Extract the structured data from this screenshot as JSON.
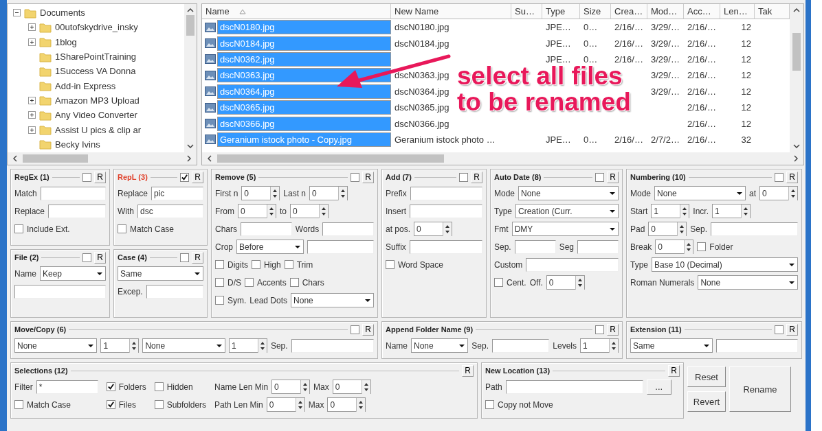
{
  "tree": {
    "items": [
      {
        "label": "Documents",
        "expanded": true,
        "children": [
          {
            "label": "00utofskydrive_insky",
            "expanded": false
          },
          {
            "label": "1blog",
            "expanded": false
          },
          {
            "label": "1SharePointTraining"
          },
          {
            "label": "1Success VA Donna"
          },
          {
            "label": "Add-in Express"
          },
          {
            "label": "Amazon MP3 Upload",
            "expanded": false
          },
          {
            "label": "Any Video Converter",
            "expanded": false
          },
          {
            "label": "Assist U pics & clip ar",
            "expanded": false
          },
          {
            "label": "Becky Ivins"
          }
        ]
      }
    ]
  },
  "file_list": {
    "columns": [
      "Name",
      "New Name",
      "Su…",
      "Type",
      "Size",
      "Crea…",
      "Mod…",
      "Acc…",
      "Len…",
      "Tak"
    ],
    "rows": [
      {
        "selected": true,
        "cells": [
          "dscN0180.jpg",
          "dscN0180.jpg",
          null,
          "JPE…",
          "0…",
          "2/16/…",
          "3/29/…",
          "2/16/…",
          "12"
        ]
      },
      {
        "selected": true,
        "cells": [
          "dscN0184.jpg",
          "dscN0184.jpg",
          null,
          "JPE…",
          "0…",
          "2/16/…",
          "3/29/…",
          "2/16/…",
          "12"
        ]
      },
      {
        "selected": true,
        "cells": [
          "dscN0362.jpg",
          null,
          null,
          "JPE…",
          "0…",
          "2/16/…",
          "3/29/…",
          "2/16/…",
          "12"
        ]
      },
      {
        "selected": true,
        "cells": [
          "dscN0363.jpg",
          "dscN0363.jpg",
          null,
          null,
          null,
          null,
          "3/29/…",
          "2/16/…",
          "12"
        ]
      },
      {
        "selected": true,
        "cells": [
          "dscN0364.jpg",
          "dscN0364.jpg",
          null,
          null,
          null,
          null,
          "3/29/…",
          "2/16/…",
          "12"
        ]
      },
      {
        "selected": true,
        "cells": [
          "dscN0365.jpg",
          "dscN0365.jpg",
          null,
          null,
          null,
          null,
          null,
          "2/16/…",
          "12"
        ]
      },
      {
        "selected": true,
        "cells": [
          "dscN0366.jpg",
          "dscN0366.jpg",
          null,
          null,
          null,
          null,
          null,
          "2/16/…",
          "12"
        ]
      },
      {
        "selected": true,
        "cells": [
          "Geranium istock photo - Copy.jpg",
          "Geranium istock photo …",
          null,
          "JPE…",
          "0…",
          "2/16/…",
          "2/7/2…",
          "2/16/…",
          "32"
        ]
      }
    ]
  },
  "annotation": {
    "lines": [
      "select all files",
      "to be renamed"
    ]
  },
  "panel_grid": {
    "columns": [
      [
        {
          "title": "RegEx (1)",
          "enabled": false,
          "r_button": "R",
          "rows": [
            [
              {
                "kind": "label",
                "text": "Match"
              },
              {
                "kind": "input"
              }
            ],
            [
              {
                "kind": "label",
                "text": "Replace"
              },
              {
                "kind": "input"
              }
            ],
            [
              {
                "kind": "check",
                "label": "Include Ext.",
                "checked": false
              }
            ]
          ]
        },
        {
          "title": "File (2)",
          "enabled": false,
          "r_button": "R",
          "rows": [
            [
              {
                "kind": "label",
                "text": "Name"
              },
              {
                "kind": "select",
                "value": "Keep"
              }
            ],
            [
              {
                "kind": "input"
              }
            ]
          ]
        }
      ],
      [
        {
          "title": "RepL (3)",
          "enabled": true,
          "r_button": "R",
          "rows": [
            [
              {
                "kind": "label",
                "text": "Replace"
              },
              {
                "kind": "input",
                "value": "pic"
              }
            ],
            [
              {
                "kind": "label",
                "text": "With"
              },
              {
                "kind": "input",
                "value": "dsc"
              }
            ],
            [
              {
                "kind": "check",
                "label": "Match Case",
                "checked": false
              }
            ]
          ]
        },
        {
          "title": "Case (4)",
          "enabled": false,
          "r_button": "R",
          "rows": [
            [
              {
                "kind": "select",
                "value": "Same"
              }
            ],
            [
              {
                "kind": "label",
                "text": "Excep."
              },
              {
                "kind": "input"
              }
            ]
          ]
        }
      ],
      [
        {
          "title": "Remove (5)",
          "enabled": false,
          "r_button": "R",
          "rows": [
            [
              {
                "kind": "label",
                "text": "First n"
              },
              {
                "kind": "spin",
                "value": "0"
              },
              {
                "kind": "label",
                "text": "Last n"
              },
              {
                "kind": "spin",
                "value": "0"
              }
            ],
            [
              {
                "kind": "label",
                "text": "From"
              },
              {
                "kind": "spin",
                "value": "0"
              },
              {
                "kind": "label",
                "text": "to"
              },
              {
                "kind": "spin",
                "value": "0"
              }
            ],
            [
              {
                "kind": "label",
                "text": "Chars"
              },
              {
                "kind": "input"
              },
              {
                "kind": "label",
                "text": "Words"
              },
              {
                "kind": "input"
              }
            ],
            [
              {
                "kind": "label",
                "text": "Crop"
              },
              {
                "kind": "select",
                "value": "Before"
              },
              {
                "kind": "input"
              }
            ],
            [
              {
                "kind": "check",
                "label": "Digits",
                "checked": false
              },
              {
                "kind": "check",
                "label": "High",
                "checked": false
              },
              {
                "kind": "check",
                "label": "Trim",
                "checked": false
              }
            ],
            [
              {
                "kind": "check",
                "label": "D/S",
                "checked": false
              },
              {
                "kind": "check",
                "label": "Accents",
                "checked": false
              },
              {
                "kind": "check",
                "label": "Chars",
                "checked": false
              }
            ],
            [
              {
                "kind": "check",
                "label": "Sym.",
                "checked": false
              },
              {
                "kind": "label",
                "text": "Lead Dots"
              },
              {
                "kind": "select",
                "value": "None"
              }
            ]
          ]
        }
      ],
      [
        {
          "title": "Add (7)",
          "enabled": false,
          "r_button": "R",
          "rows": [
            [
              {
                "kind": "label",
                "text": "Prefix"
              },
              {
                "kind": "input"
              }
            ],
            [
              {
                "kind": "label",
                "text": "Insert"
              },
              {
                "kind": "input"
              }
            ],
            [
              {
                "kind": "label",
                "text": "at pos."
              },
              {
                "kind": "spin",
                "value": "0"
              }
            ],
            [
              {
                "kind": "label",
                "text": "Suffix"
              },
              {
                "kind": "input"
              }
            ],
            [
              {
                "kind": "check",
                "label": "Word Space",
                "checked": false
              }
            ]
          ]
        }
      ],
      [
        {
          "title": "Auto Date (8)",
          "enabled": false,
          "r_button": "R",
          "rows": [
            [
              {
                "kind": "label",
                "text": "Mode"
              },
              {
                "kind": "select",
                "value": "None"
              }
            ],
            [
              {
                "kind": "label",
                "text": "Type"
              },
              {
                "kind": "select",
                "value": "Creation (Curr."
              }
            ],
            [
              {
                "kind": "label",
                "text": "Fmt"
              },
              {
                "kind": "select",
                "value": "DMY"
              }
            ],
            [
              {
                "kind": "label",
                "text": "Sep."
              },
              {
                "kind": "input"
              },
              {
                "kind": "label",
                "text": "Seg"
              },
              {
                "kind": "input"
              }
            ],
            [
              {
                "kind": "label",
                "text": "Custom"
              },
              {
                "kind": "input"
              }
            ],
            [
              {
                "kind": "check",
                "label": "Cent.",
                "checked": false
              },
              {
                "kind": "label",
                "text": "Off."
              },
              {
                "kind": "spin",
                "value": "0"
              }
            ]
          ]
        }
      ],
      [
        {
          "title": "Numbering (10)",
          "enabled": false,
          "r_button": "R",
          "rows": [
            [
              {
                "kind": "label",
                "text": "Mode"
              },
              {
                "kind": "select",
                "value": "None"
              },
              {
                "kind": "label",
                "text": "at"
              },
              {
                "kind": "spin",
                "value": "0"
              }
            ],
            [
              {
                "kind": "label",
                "text": "Start"
              },
              {
                "kind": "spin",
                "value": "1"
              },
              {
                "kind": "label",
                "text": "Incr."
              },
              {
                "kind": "spin",
                "value": "1"
              }
            ],
            [
              {
                "kind": "label",
                "text": "Pad"
              },
              {
                "kind": "spin",
                "value": "0"
              },
              {
                "kind": "label",
                "text": "Sep."
              },
              {
                "kind": "input"
              }
            ],
            [
              {
                "kind": "label",
                "text": "Break"
              },
              {
                "kind": "spin",
                "value": "0"
              },
              {
                "kind": "check",
                "label": "Folder",
                "checked": false
              }
            ],
            [
              {
                "kind": "label",
                "text": "Type"
              },
              {
                "kind": "select",
                "value": "Base 10 (Decimal)"
              }
            ],
            [
              {
                "kind": "label",
                "text": "Roman Numerals"
              },
              {
                "kind": "select",
                "value": "None"
              }
            ]
          ]
        }
      ]
    ],
    "wide": [
      {
        "title": "Move/Copy (6)",
        "enabled": false,
        "r_button": "R",
        "rows": [
          [
            {
              "kind": "select",
              "value": "None"
            },
            {
              "kind": "spin",
              "value": "1"
            },
            {
              "kind": "select",
              "value": "None"
            },
            {
              "kind": "spin",
              "value": "1"
            },
            {
              "kind": "label",
              "text": "Sep."
            },
            {
              "kind": "input"
            }
          ]
        ]
      },
      {
        "title": "Append Folder Name (9)",
        "enabled": false,
        "r_button": "R",
        "rows": [
          [
            {
              "kind": "label",
              "text": "Name"
            },
            {
              "kind": "select",
              "value": "None"
            },
            {
              "kind": "label",
              "text": "Sep."
            },
            {
              "kind": "input"
            },
            {
              "kind": "label",
              "text": "Levels"
            },
            {
              "kind": "spin",
              "value": "1"
            }
          ]
        ]
      },
      {
        "title": "Extension (11)",
        "enabled": false,
        "r_button": "R",
        "rows": [
          [
            {
              "kind": "select",
              "value": "Same"
            },
            {
              "kind": "input"
            }
          ]
        ]
      }
    ]
  },
  "bottom": {
    "panels": [
      {
        "title": "Selections (12)",
        "r_button": "R",
        "groups": [
          [
            [
              {
                "kind": "label",
                "text": "Filter"
              },
              {
                "kind": "input",
                "value": "*"
              }
            ],
            [
              {
                "kind": "check",
                "label": "Match Case",
                "checked": false
              }
            ]
          ],
          [
            [
              {
                "kind": "check",
                "label": "Folders",
                "checked": true
              }
            ],
            [
              {
                "kind": "check",
                "label": "Files",
                "checked": true
              }
            ]
          ],
          [
            [
              {
                "kind": "check",
                "label": "Hidden",
                "checked": false
              }
            ],
            [
              {
                "kind": "check",
                "label": "Subfolders",
                "checked": false
              }
            ]
          ],
          [
            [
              {
                "kind": "label",
                "text": "Name Len Min"
              },
              {
                "kind": "spin",
                "value": "0"
              },
              {
                "kind": "label",
                "text": "Max"
              },
              {
                "kind": "spin",
                "value": "0"
              }
            ],
            [
              {
                "kind": "label",
                "text": "Path Len Min"
              },
              {
                "kind": "spin",
                "value": "0"
              },
              {
                "kind": "label",
                "text": "Max"
              },
              {
                "kind": "spin",
                "value": "0"
              }
            ]
          ]
        ]
      },
      {
        "title": "New Location (13)",
        "r_button": "R",
        "rows": [
          [
            {
              "kind": "label",
              "text": "Path"
            },
            {
              "kind": "input"
            },
            {
              "kind": "button",
              "label": "..."
            }
          ],
          [
            {
              "kind": "check",
              "label": "Copy not Move",
              "checked": false
            }
          ]
        ]
      }
    ],
    "buttons": [
      {
        "label": "Reset"
      },
      {
        "label": "Revert"
      },
      {
        "label": "Rename"
      }
    ]
  }
}
